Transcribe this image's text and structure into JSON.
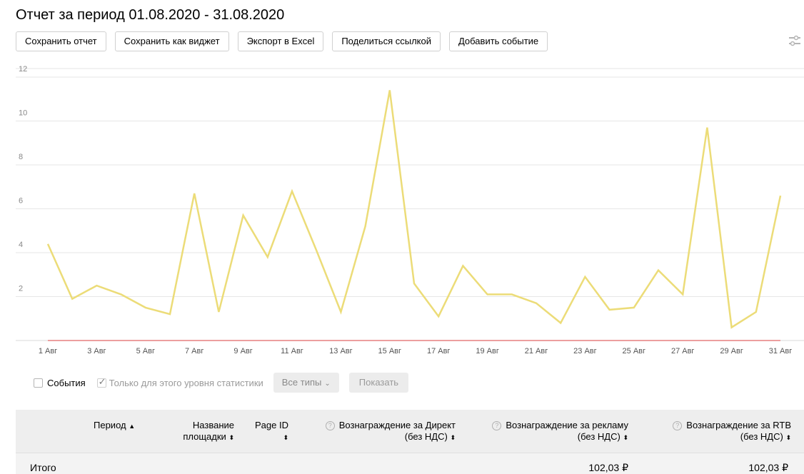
{
  "title": "Отчет за период 01.08.2020 - 31.08.2020",
  "toolbar": {
    "save_report": "Сохранить отчет",
    "save_widget": "Сохранить как виджет",
    "export_excel": "Экспорт в Excel",
    "share_link": "Поделиться ссылкой",
    "add_event": "Добавить событие"
  },
  "icons": {
    "settings": "sliders-icon"
  },
  "chart_data": {
    "type": "line",
    "x": [
      "1 Авг",
      "2 Авг",
      "3 Авг",
      "4 Авг",
      "5 Авг",
      "6 Авг",
      "7 Авг",
      "8 Авг",
      "9 Авг",
      "10 Авг",
      "11 Авг",
      "12 Авг",
      "13 Авг",
      "14 Авг",
      "15 Авг",
      "16 Авг",
      "17 Авг",
      "18 Авг",
      "19 Авг",
      "20 Авг",
      "21 Авг",
      "22 Авг",
      "23 Авг",
      "24 Авг",
      "25 Авг",
      "26 Авг",
      "27 Авг",
      "28 Авг",
      "29 Авг",
      "30 Авг",
      "31 Авг"
    ],
    "tick_labels": [
      "1 Авг",
      "3 Авг",
      "5 Авг",
      "7 Авг",
      "9 Авг",
      "11 Авг",
      "13 Авг",
      "15 Авг",
      "17 Авг",
      "19 Авг",
      "21 Авг",
      "23 Авг",
      "25 Авг",
      "27 Авг",
      "29 Авг",
      "31 Авг"
    ],
    "y_ticks": [
      "2",
      "4",
      "6",
      "8",
      "10",
      "12"
    ],
    "ylim": [
      0,
      12
    ],
    "grid": true,
    "series": [
      {
        "color": "#ecdc78",
        "values": [
          4.4,
          1.9,
          2.5,
          2.1,
          1.5,
          1.2,
          6.7,
          1.3,
          5.7,
          3.8,
          6.8,
          4.1,
          1.3,
          5.2,
          11.4,
          2.6,
          1.1,
          3.4,
          2.1,
          2.1,
          1.7,
          0.8,
          2.9,
          1.4,
          1.5,
          3.2,
          2.1,
          9.7,
          0.6,
          1.3,
          6.6
        ]
      },
      {
        "color": "#e06666",
        "values": [
          0,
          0,
          0,
          0,
          0,
          0,
          0,
          0,
          0,
          0,
          0,
          0,
          0,
          0,
          0,
          0,
          0,
          0,
          0,
          0,
          0,
          0,
          0,
          0,
          0,
          0,
          0,
          0,
          0,
          0,
          0
        ]
      }
    ]
  },
  "controls": {
    "events_label": "События",
    "only_level_label": "Только для этого уровня статистики",
    "types_label": "Все типы",
    "show_label": "Показать"
  },
  "table": {
    "headers": {
      "period": "Период",
      "site_name_1": "Название",
      "site_name_2": "площадки",
      "page_id": "Page ID",
      "direct_1": "Вознаграждение за Директ",
      "direct_2": "(без НДС)",
      "ads_1": "Вознаграждение за рекламу",
      "ads_2": "(без НДС)",
      "rtb_1": "Вознаграждение за RTB",
      "rtb_2": "(без НДС)"
    },
    "sort_up": "▲",
    "sort_both": "⬍",
    "help_glyph": "?",
    "total_label": "Итого",
    "total_ads": "102,03 ₽",
    "total_rtb": "102,03 ₽"
  }
}
